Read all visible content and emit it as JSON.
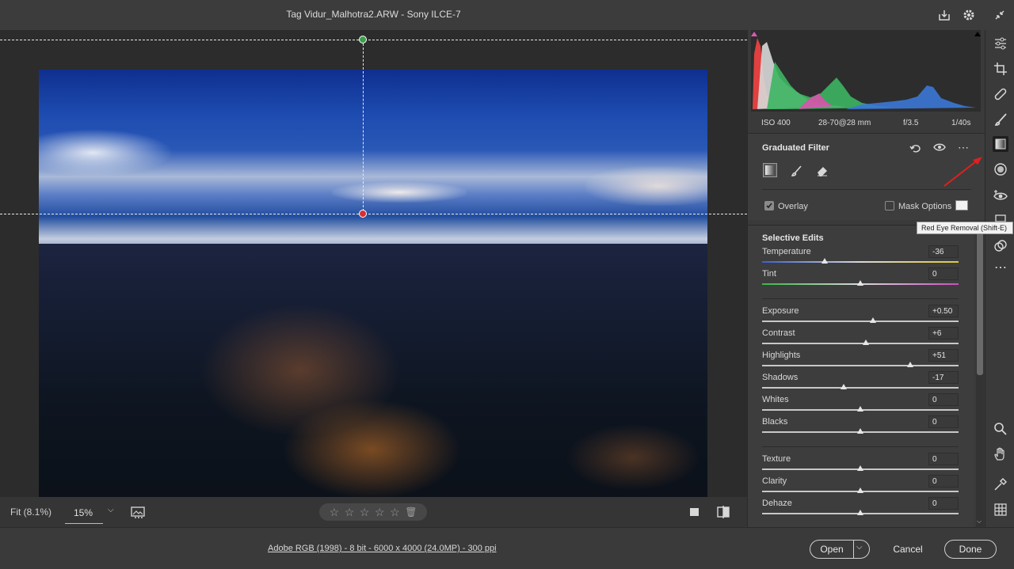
{
  "window": {
    "title": "Tag Vidur_Malhotra2.ARW  -  Sony ILCE-7"
  },
  "bottom_bar": {
    "fit_label": "Fit (8.1%)",
    "zoom_value": "15%",
    "rating_stars": 0
  },
  "footer": {
    "file_info": "Adobe RGB (1998) - 8 bit - 6000 x 4000 (24.0MP) - 300 ppi",
    "open_label": "Open",
    "cancel_label": "Cancel",
    "done_label": "Done"
  },
  "camera": {
    "iso": "ISO 400",
    "lens": "28-70@28 mm",
    "aperture": "f/3.5",
    "shutter": "1/40s"
  },
  "graduated_filter": {
    "title": "Graduated Filter",
    "overlay_label": "Overlay",
    "overlay_checked": true,
    "mask_options_label": "Mask Options",
    "mask_options_checked": false
  },
  "selective_edits": {
    "title": "Selective Edits",
    "group1": [
      {
        "label": "Temperature",
        "value": "-36",
        "pos": -36
      },
      {
        "label": "Tint",
        "value": "0",
        "pos": 0
      }
    ],
    "group2": [
      {
        "label": "Exposure",
        "value": "+0.50",
        "pos": 12.5
      },
      {
        "label": "Contrast",
        "value": "+6",
        "pos": 6
      },
      {
        "label": "Highlights",
        "value": "+51",
        "pos": 51
      },
      {
        "label": "Shadows",
        "value": "-17",
        "pos": -17
      },
      {
        "label": "Whites",
        "value": "0",
        "pos": 0
      },
      {
        "label": "Blacks",
        "value": "0",
        "pos": 0
      }
    ],
    "group3": [
      {
        "label": "Texture",
        "value": "0",
        "pos": 0
      },
      {
        "label": "Clarity",
        "value": "0",
        "pos": 0
      },
      {
        "label": "Dehaze",
        "value": "0",
        "pos": 0
      }
    ]
  },
  "tooltip": {
    "text": "Red Eye Removal (Shift-E)"
  },
  "colors": {
    "accent_red": "#e0201f",
    "panel_bg": "#3d3d3d"
  },
  "icons": [
    "save-icon",
    "gear-icon",
    "collapse-icon",
    "edit-sliders-icon",
    "crop-icon",
    "healing-icon",
    "brush-icon",
    "graduated-filter-icon",
    "radial-filter-icon",
    "red-eye-icon",
    "snapshots-icon",
    "presets-icon",
    "more-icon",
    "zoom-icon",
    "hand-icon",
    "sampler-icon",
    "grid-icon"
  ]
}
